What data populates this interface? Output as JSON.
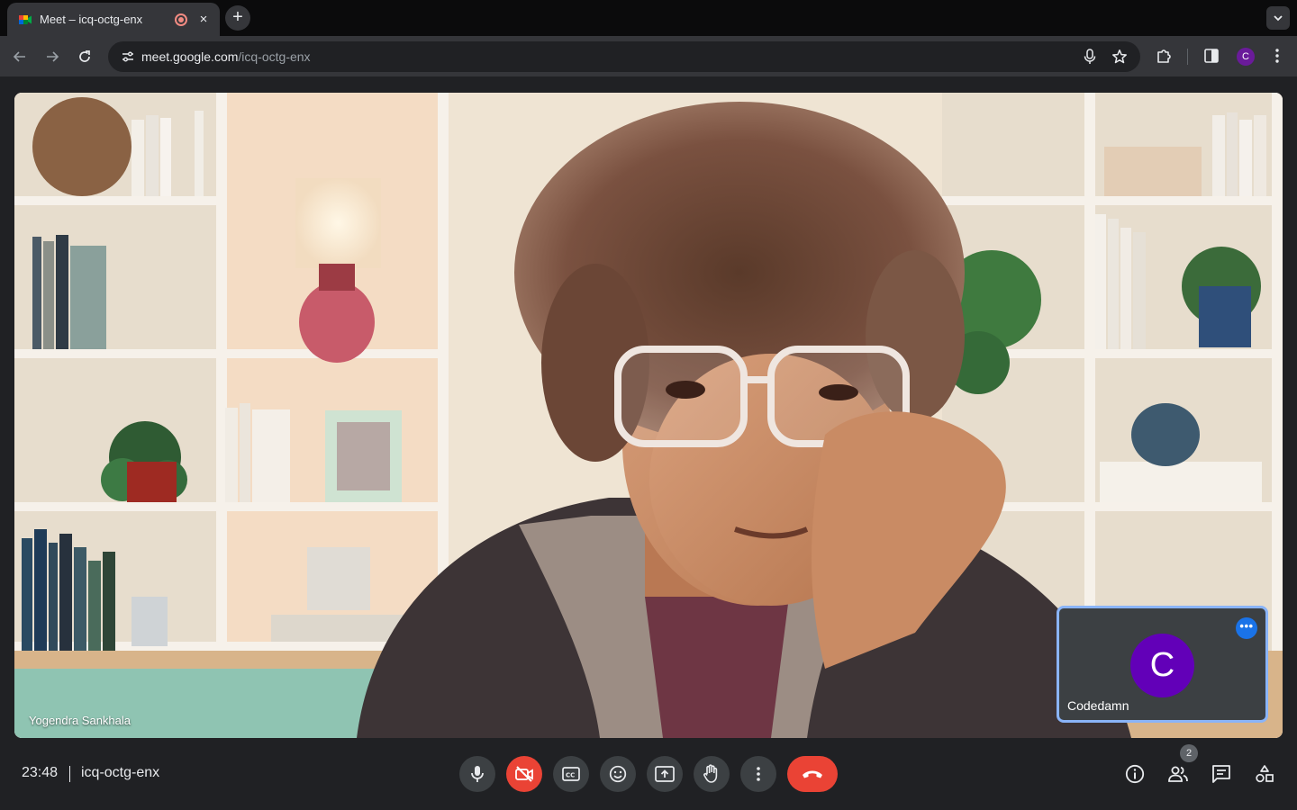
{
  "browser": {
    "tab_title": "Meet – icq-octg-enx",
    "close_glyph": "×",
    "new_tab_glyph": "+",
    "url_host": "meet.google.com",
    "url_path": "/icq-octg-enx",
    "profile_initial": "C",
    "accent": "#8ab4f8"
  },
  "meeting": {
    "speaker_name": "Yogendra Sankhala",
    "self_name": "Codedamn",
    "self_initial": "C",
    "self_avatar_color": "#6200b8",
    "more_glyph": "•••",
    "clock": "23:48",
    "code": "icq-octg-enx",
    "participant_count": "2",
    "end_call_color": "#ea4335"
  },
  "controls": {
    "icons": [
      "mic-icon",
      "camera-off-icon",
      "captions-icon",
      "emoji-icon",
      "present-icon",
      "raise-hand-icon",
      "more-options-icon",
      "end-call-icon"
    ],
    "right_icons": [
      "info-icon",
      "people-icon",
      "chat-icon",
      "activities-icon"
    ]
  }
}
